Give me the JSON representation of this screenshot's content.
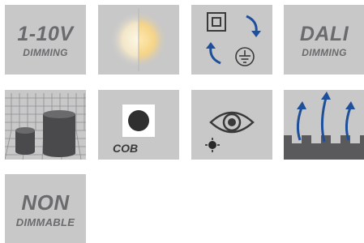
{
  "tiles": {
    "dimming_1_10v": {
      "title": "1-10V",
      "subtitle": "DIMMING",
      "icon": "text-badge"
    },
    "color_temperature": {
      "icon": "warm-cool-split-light-icon"
    },
    "class_ii_grounding": {
      "icon": "double-insulation-ground-icon"
    },
    "dali": {
      "title": "DALI",
      "subtitle": "DIMMING",
      "icon": "text-badge"
    },
    "size_comparison": {
      "icon": "cylinder-grid-icon"
    },
    "cob": {
      "label": "COB",
      "icon": "cob-chip-icon"
    },
    "glare": {
      "icon": "eye-icon"
    },
    "heat_dissipation": {
      "icon": "heat-sink-airflow-icon"
    },
    "non_dimmable": {
      "title": "NON",
      "subtitle": "DIMMABLE",
      "icon": "text-badge"
    }
  },
  "colors": {
    "tile_bg": "#c8c8c9",
    "label_gray": "#6b6b6e",
    "arrow_blue": "#1e4f9a",
    "dark_gray": "#4a4a4a",
    "warm_light": "#f5c86a"
  }
}
